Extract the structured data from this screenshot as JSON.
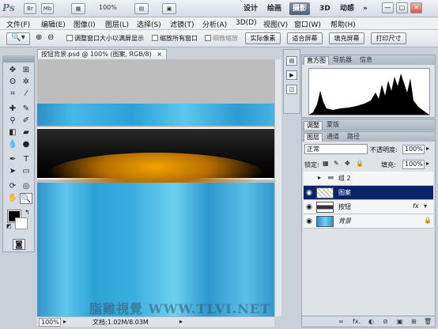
{
  "appbar": {
    "logo": "Ps",
    "zoom": "100%",
    "workspaces": [
      "设计",
      "绘画",
      "摄影",
      "3D",
      "动感"
    ],
    "expand": "»",
    "win_controls": [
      "—",
      "▢",
      "✕"
    ]
  },
  "menubar": {
    "items": [
      "文件(F)",
      "编辑(E)",
      "图像(I)",
      "图层(L)",
      "选择(S)",
      "滤镜(T)",
      "分析(A)",
      "3D(D)",
      "视图(V)",
      "窗口(W)",
      "帮助(H)"
    ]
  },
  "options": {
    "fit_window": "调整窗口大小以满屏显示",
    "zoom_all": "缩放所有窗口",
    "scrubby": "细微缩放",
    "actual_pixels": "实际像素",
    "fit_screen": "适合屏幕",
    "fill_screen": "填充屏幕",
    "print_size": "打印尺寸"
  },
  "document": {
    "tab_title": "按钮背景.psd @ 100% (图案, RGB/8)",
    "zoom": "100%",
    "doc_info": "文档:1.02M/8.03M",
    "watermark": "脂雞視覺 WWW.TLVI.NET"
  },
  "histogram_panel": {
    "tabs": [
      "直方图",
      "导航器",
      "信息"
    ]
  },
  "adjust_panel": {
    "tabs": [
      "调整",
      "蒙版"
    ]
  },
  "layers_panel": {
    "tabs": [
      "图层",
      "通道",
      "路径"
    ],
    "blend_mode": "正常",
    "opacity_label": "不透明度:",
    "opacity": "100%",
    "lock_label": "锁定:",
    "fill_label": "填充:",
    "fill": "100%",
    "layers": [
      {
        "name": "组 2",
        "type": "group"
      },
      {
        "name": "图案",
        "type": "pattern",
        "selected": true
      },
      {
        "name": "按钮",
        "type": "button",
        "fx": "fx"
      },
      {
        "name": "背景",
        "type": "background"
      }
    ],
    "bottom_icons": [
      "∞",
      "fx.",
      "◐",
      "⊘",
      "▣",
      "⊞",
      "🗑"
    ]
  },
  "colors": {
    "selection": "#0a246a",
    "accent_glow": "#f2a400"
  }
}
